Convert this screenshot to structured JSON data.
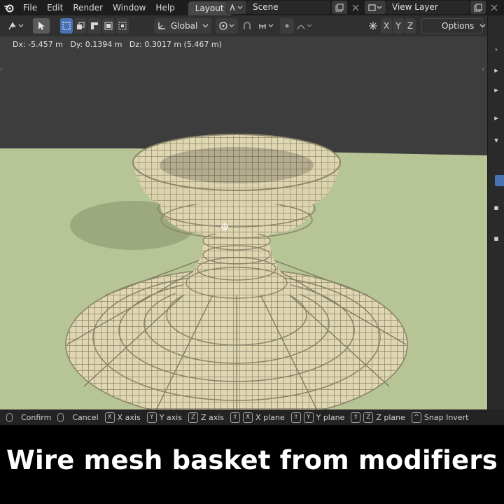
{
  "topbar": {
    "menu": [
      "File",
      "Edit",
      "Render",
      "Window",
      "Help"
    ],
    "workspace_tab": "Layout",
    "scene_label": "Scene",
    "view_layer_label": "View Layer"
  },
  "header": {
    "orientation": "Global",
    "options_label": "Options",
    "axis_x": "X",
    "axis_y": "Y",
    "axis_z": "Z"
  },
  "viewport": {
    "transform_info": "Dx: -5.457 m   Dy: 0.1394 m   Dz: 0.3017 m (5.467 m)",
    "ground_color": "#b6c496",
    "mesh_color": "#c9c09a"
  },
  "statusbar": {
    "confirm": "Confirm",
    "cancel": "Cancel",
    "x_axis_key": "X",
    "x_axis": "X axis",
    "y_axis_key": "Y",
    "y_axis": "Y axis",
    "z_axis_key": "Z",
    "z_axis": "Z axis",
    "x_plane": "X plane",
    "y_plane": "Y plane",
    "z_plane": "Z plane",
    "snap_invert": "Snap Invert"
  },
  "caption": "Wire mesh basket from modifiers"
}
